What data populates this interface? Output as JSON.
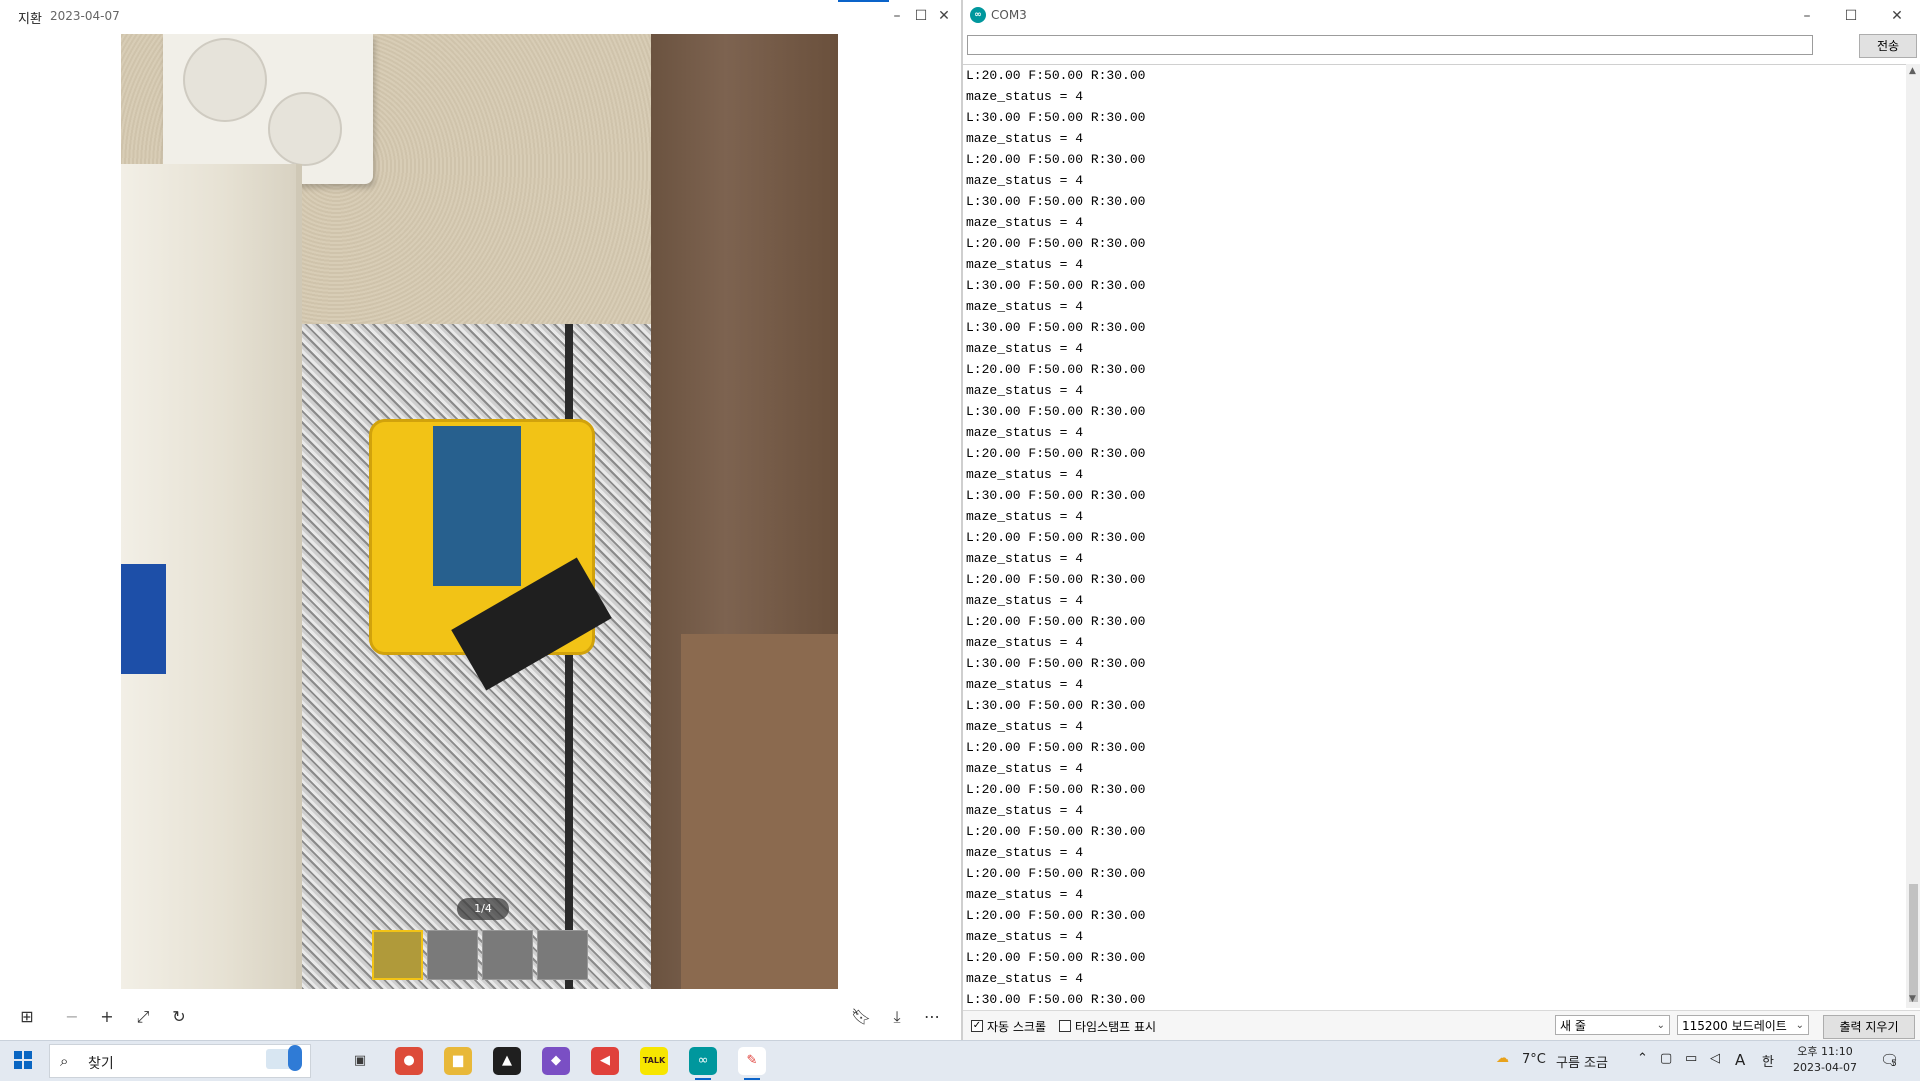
{
  "viewer": {
    "title": "지환",
    "date": "2023-04-07",
    "counter": "1/4",
    "thumbnails": [
      {
        "id": "thumb-1",
        "active": true
      },
      {
        "id": "thumb-2",
        "active": false
      },
      {
        "id": "thumb-3",
        "active": false
      },
      {
        "id": "thumb-4",
        "active": false
      }
    ],
    "toolbar": {
      "grid_icon": "grid-icon",
      "zoom_out_icon": "minus-icon",
      "zoom_in_icon": "plus-icon",
      "fit_icon": "expand-icon",
      "rotate_icon": "rotate-icon",
      "bookmark_icon": "bookmark-icon",
      "download_icon": "download-icon",
      "more_icon": "more-icon"
    }
  },
  "serial": {
    "title": "COM3",
    "input_value": "",
    "send_label": "전송",
    "lines": [
      "L:20.00 F:50.00 R:30.00",
      "maze_status = 4",
      "L:30.00 F:50.00 R:30.00",
      "maze_status = 4",
      "L:20.00 F:50.00 R:30.00",
      "maze_status = 4",
      "L:30.00 F:50.00 R:30.00",
      "maze_status = 4",
      "L:20.00 F:50.00 R:30.00",
      "maze_status = 4",
      "L:30.00 F:50.00 R:30.00",
      "maze_status = 4",
      "L:30.00 F:50.00 R:30.00",
      "maze_status = 4",
      "L:20.00 F:50.00 R:30.00",
      "maze_status = 4",
      "L:30.00 F:50.00 R:30.00",
      "maze_status = 4",
      "L:20.00 F:50.00 R:30.00",
      "maze_status = 4",
      "L:30.00 F:50.00 R:30.00",
      "maze_status = 4",
      "L:20.00 F:50.00 R:30.00",
      "maze_status = 4",
      "L:20.00 F:50.00 R:30.00",
      "maze_status = 4",
      "L:20.00 F:50.00 R:30.00",
      "maze_status = 4",
      "L:30.00 F:50.00 R:30.00",
      "maze_status = 4",
      "L:30.00 F:50.00 R:30.00",
      "maze_status = 4",
      "L:20.00 F:50.00 R:30.00",
      "maze_status = 4",
      "L:20.00 F:50.00 R:30.00",
      "maze_status = 4",
      "L:20.00 F:50.00 R:30.00",
      "maze_status = 4",
      "L:20.00 F:50.00 R:30.00",
      "maze_status = 4",
      "L:20.00 F:50.00 R:30.00",
      "maze_status = 4",
      "L:20.00 F:50.00 R:30.00",
      "maze_status = 4",
      "L:30.00 F:50.00 R:30.00",
      "maze_status = 4"
    ],
    "autoscroll_label": "자동 스크롤",
    "autoscroll_checked": true,
    "timestamp_label": "타임스탬프 표시",
    "timestamp_checked": false,
    "line_ending": "새 줄",
    "baud_rate": "115200 보드레이트",
    "clear_label": "출력 지우기"
  },
  "taskbar": {
    "search_text": "찾기",
    "apps": [
      {
        "name": "task-view-icon",
        "color": "#3b3b3b",
        "glyph": "▣"
      },
      {
        "name": "chrome-icon",
        "color": "#dd4b39",
        "glyph": "●"
      },
      {
        "name": "file-explorer-icon",
        "color": "#e8b839",
        "glyph": "▆"
      },
      {
        "name": "ide-icon",
        "color": "#1f1f1f",
        "glyph": "▲"
      },
      {
        "name": "visual-studio-icon",
        "color": "#7a4fc4",
        "glyph": "◆"
      },
      {
        "name": "app-red-icon",
        "color": "#e0413b",
        "glyph": "◀"
      },
      {
        "name": "kakaotalk-icon",
        "color": "#f7e600",
        "glyph": "TALK"
      },
      {
        "name": "arduino-icon",
        "color": "#00979d",
        "glyph": "∞"
      },
      {
        "name": "paint-icon",
        "color": "#ffffff",
        "glyph": "✎"
      }
    ],
    "weather_temp": "7°C",
    "weather_text": "구름 조금",
    "ime_a": "A",
    "ime_lang": "한",
    "time": "오후 11:10",
    "date": "2023-04-07",
    "notification_count": "5"
  }
}
